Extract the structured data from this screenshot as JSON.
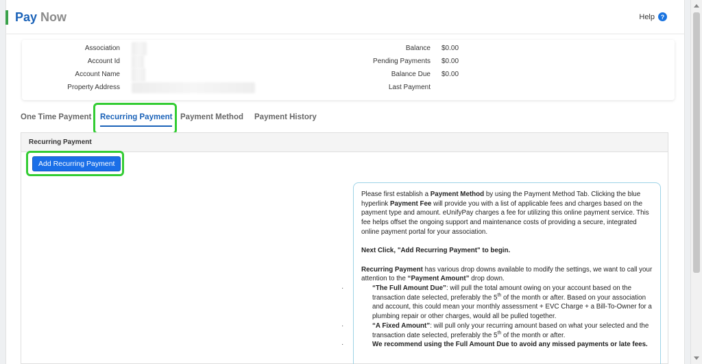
{
  "header": {
    "title_part1": "Pay",
    "title_part2": "Now",
    "help_label": "Help",
    "help_icon": "?"
  },
  "account_info": {
    "left": [
      {
        "label": "Association",
        "value": ""
      },
      {
        "label": "Account Id",
        "value": ""
      },
      {
        "label": "Account Name",
        "value": ""
      },
      {
        "label": "Property Address",
        "value": ""
      }
    ],
    "right": [
      {
        "label": "Balance",
        "value": "$0.00"
      },
      {
        "label": "Pending Payments",
        "value": "$0.00"
      },
      {
        "label": "Balance Due",
        "value": "$0.00"
      },
      {
        "label": "Last Payment",
        "value": ""
      }
    ]
  },
  "tabs": [
    {
      "label": "One Time Payment",
      "active": false
    },
    {
      "label": "Recurring Payment",
      "active": true
    },
    {
      "label": "Payment Method",
      "active": false
    },
    {
      "label": "Payment History",
      "active": false
    }
  ],
  "panel": {
    "title": "Recurring Payment",
    "add_button_label": "Add Recurring Payment",
    "instructions": {
      "p1_a": "Please first establish a ",
      "p1_b": "Payment Method",
      "p1_c": " by using the Payment Method Tab. Clicking the blue hyperlink ",
      "p1_d": "Payment Fee",
      "p1_e": " will provide you with a list of applicable fees and charges based on the payment type and amount. eUnifyPay charges a fee for utilizing this online payment service. This fee helps offset the ongoing support and maintenance costs of providing a secure, integrated online payment portal for your association.",
      "p2": "Next Click, \"Add Recurring Payment\" to begin.",
      "p3_a": "Recurring Payment",
      "p3_b": " has various drop downs available to modify the settings, we want to call your attention to the ",
      "p3_c": "“Payment Amount”",
      "p3_d": " drop down.",
      "b1_a": "“The Full Amount Due”",
      "b1_b": ": will pull the total amount owing on your account based on the transaction date selected, preferably the 5",
      "b1_sup": "th",
      "b1_c": " of the month or after. Based on your association and account, this could mean your monthly assessment + EVC Charge +  a Bill-To-Owner for a plumbing repair or other charges, would all be pulled together.",
      "b2_a": "“A Fixed Amount”",
      "b2_b": ": will pull only your recurring amount based on what your selected and the transaction date selected, preferably the 5",
      "b2_sup": "th",
      "b2_c": " of the month or after.",
      "b3": "We recommend using the Full Amount Due to avoid any missed payments or late fees.",
      "bullet_char": "·"
    }
  },
  "colors": {
    "accent": "#3aa14a",
    "brand_blue": "#1a62b8",
    "button_blue": "#1a6fe8",
    "highlight_green": "#33cc33"
  }
}
